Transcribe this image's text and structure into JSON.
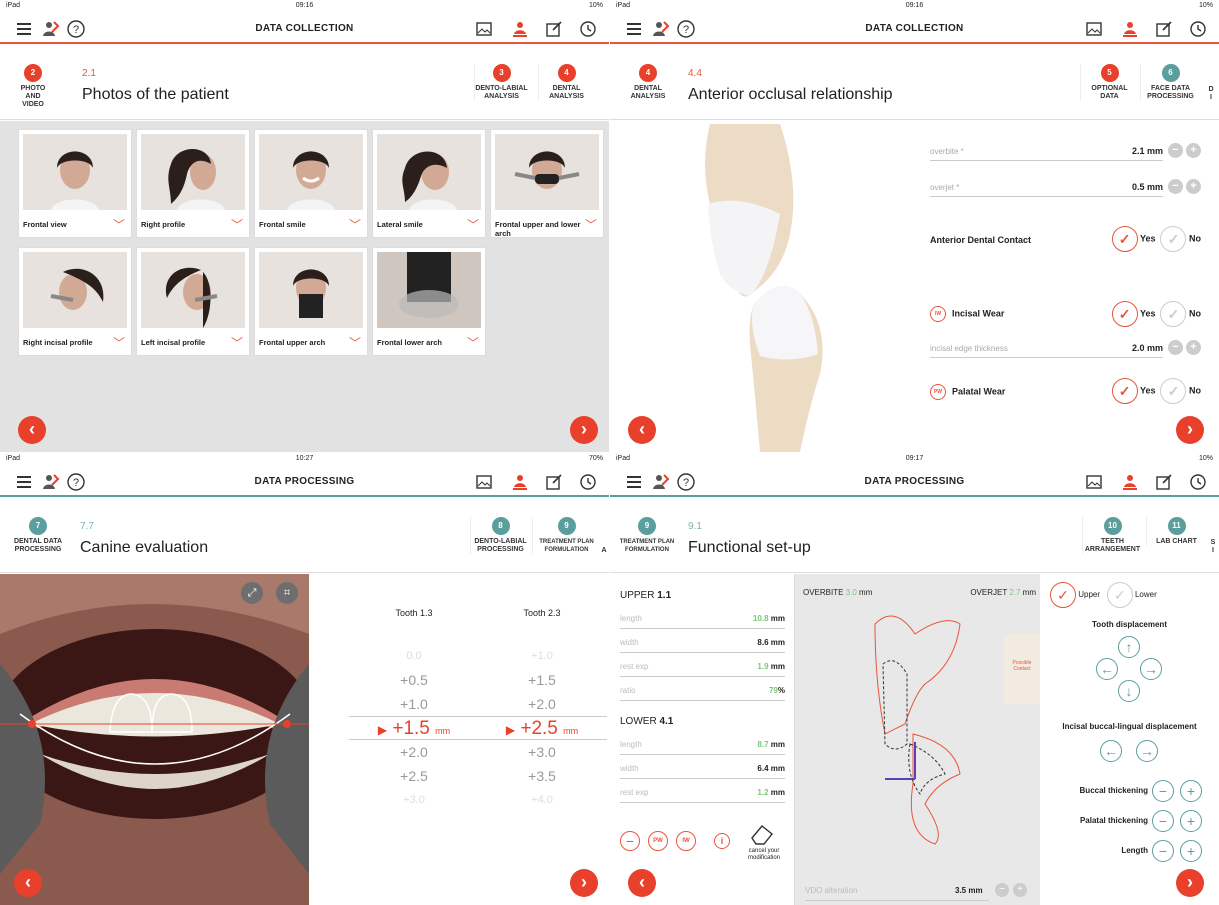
{
  "q1": {
    "status": {
      "left": "iPad",
      "time": "09:16",
      "battery": "10%"
    },
    "title": "DATA COLLECTION",
    "current": {
      "num": "2",
      "label_line1": "PHOTO",
      "label_line2": "AND VIDEO",
      "code": "2.1",
      "title": "Photos of the patient"
    },
    "next": [
      {
        "num": "3",
        "l1": "DENTO-LABIAL",
        "l2": "ANALYSIS"
      },
      {
        "num": "4",
        "l1": "DENTAL",
        "l2": "ANALYSIS"
      }
    ],
    "photos": [
      {
        "label": "Frontal view"
      },
      {
        "label": "Right profile"
      },
      {
        "label": "Frontal smile"
      },
      {
        "label": "Lateral smile"
      },
      {
        "label": "Frontal upper and lower arch"
      },
      {
        "label": "Right incisal profile"
      },
      {
        "label": "Left incisal profile"
      },
      {
        "label": "Frontal upper arch"
      },
      {
        "label": "Frontal lower arch"
      }
    ]
  },
  "q2": {
    "status": {
      "left": "iPad",
      "time": "09:16",
      "battery": "10%"
    },
    "title": "DATA COLLECTION",
    "current": {
      "num": "4",
      "l1": "DENTAL",
      "l2": "ANALYSIS",
      "code": "4.4",
      "title": "Anterior occlusal relationship"
    },
    "next": [
      {
        "num": "5",
        "l1": "OPTIONAL",
        "l2": "DATA"
      },
      {
        "num": "6",
        "l1": "FACE DATA",
        "l2": "PROCESSING"
      },
      {
        "num": "",
        "l1": "D",
        "l2": "I"
      }
    ],
    "overbite_label": "overbite *",
    "overbite_value": "2.1 mm",
    "overjet_label": "overjet *",
    "overjet_value": "0.5 mm",
    "anterior_contact": "Anterior Dental Contact",
    "incisal_wear": "Incisal Wear",
    "iw_badge": "IW",
    "edge_label": "incisal edge thickness",
    "edge_value": "2.0 mm",
    "palatal_wear": "Palatal Wear",
    "pw_badge": "PW",
    "yes": "Yes",
    "no": "No"
  },
  "q3": {
    "status": {
      "left": "iPad",
      "time": "10:27",
      "battery": "70%"
    },
    "title": "DATA PROCESSING",
    "current": {
      "num": "7",
      "l1": "DENTAL DATA",
      "l2": "PROCESSING",
      "code": "7.7",
      "title": "Canine evaluation"
    },
    "next": [
      {
        "num": "8",
        "l1": "DENTO-LABIAL",
        "l2": "PROCESSING"
      },
      {
        "num": "9",
        "l1": "TREATMENT PLAN",
        "l2": "FORMULATION"
      },
      {
        "num": "",
        "l1": "",
        "l2": "A"
      }
    ],
    "tooth_a": "Tooth 1.3",
    "tooth_b": "Tooth 2.3",
    "wheel_a": [
      "0.0",
      "+0.5",
      "+1.0",
      "+1.5",
      "+2.0",
      "+2.5",
      "+3.0"
    ],
    "wheel_b": [
      "+1.0",
      "+1.5",
      "+2.0",
      "+2.5",
      "+3.0",
      "+3.5",
      "+4.0"
    ],
    "unit": "mm"
  },
  "q4": {
    "status": {
      "left": "iPad",
      "time": "09:17",
      "battery": "10%"
    },
    "title": "DATA PROCESSING",
    "current": {
      "num": "9",
      "l1": "TREATMENT PLAN",
      "l2": "FORMULATION",
      "code": "9.1",
      "title": "Functional set-up"
    },
    "next": [
      {
        "num": "10",
        "l1": "TEETH",
        "l2": "ARRANGEMENT"
      },
      {
        "num": "11",
        "l1": "LAB CHART",
        "l2": ""
      },
      {
        "num": "",
        "l1": "S",
        "l2": "I"
      }
    ],
    "upper_title": "UPPER",
    "upper_tooth": "1.1",
    "upper_rows": [
      {
        "k": "length",
        "v": "10.8",
        "u": "mm",
        "green": true
      },
      {
        "k": "width",
        "v": "8.6",
        "u": "mm",
        "green": false
      },
      {
        "k": "rest exp",
        "v": "1.9",
        "u": "mm",
        "green": true
      },
      {
        "k": "ratio",
        "v": "79",
        "u": "%",
        "green": true
      }
    ],
    "lower_title": "LOWER",
    "lower_tooth": "4.1",
    "lower_rows": [
      {
        "k": "length",
        "v": "8.7",
        "u": "mm",
        "green": true
      },
      {
        "k": "width",
        "v": "6.4",
        "u": "mm",
        "green": false
      },
      {
        "k": "rest exp",
        "v": "1.2",
        "u": "mm",
        "green": true
      }
    ],
    "overbite_label": "OVERBITE",
    "overbite_value": "3.0",
    "overbite_unit": "mm",
    "overjet_label": "OVERJET",
    "overjet_value": "2.7",
    "overjet_unit": "mm",
    "possible_contact": "Possible Contact",
    "vdo_label": "VDO alteration",
    "vdo_value": "3.5 mm",
    "cancel": "cancel your modification",
    "upper": "Upper",
    "lower": "Lower",
    "tooth_disp": "Tooth displacement",
    "incisal_disp": "Incisal buccal-lingual displacement",
    "buccal": "Buccal thickening",
    "palatal": "Palatal thickening",
    "length": "Length",
    "pw": "PW",
    "iw": "IW",
    "info": "i"
  },
  "colors": {
    "accent": "#e8402a",
    "teal": "#5b9e9e"
  }
}
